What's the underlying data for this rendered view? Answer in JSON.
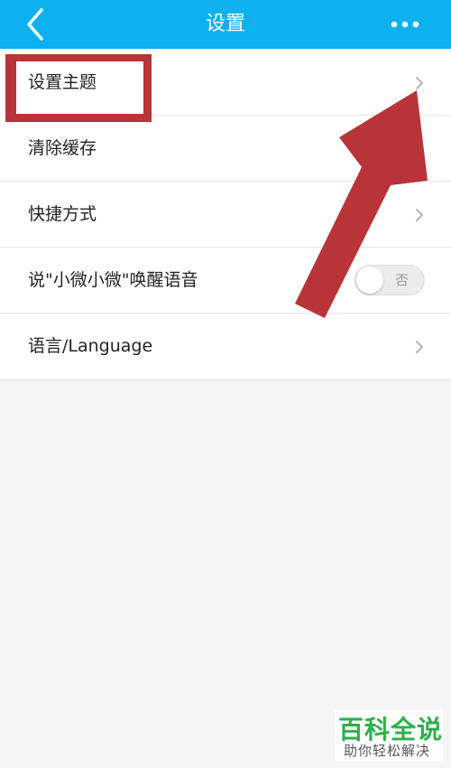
{
  "header": {
    "title": "设置",
    "back_icon": "chevron-left-icon",
    "more_icon": "more-dots-icon",
    "background": "#0db1f0"
  },
  "settings": {
    "items": [
      {
        "label": "设置主题",
        "control": "chevron-right-icon"
      },
      {
        "label": "清除缓存",
        "control": "none"
      },
      {
        "label": "快捷方式",
        "control": "chevron-right-icon"
      },
      {
        "label": "说\"小微小微\"唤醒语音",
        "control": "toggle",
        "toggle_text": "否",
        "toggle_on": false
      },
      {
        "label": "语言/Language",
        "control": "chevron-right-icon"
      }
    ]
  },
  "annotation": {
    "color": "#b83438"
  },
  "watermark": {
    "title": "百科全说",
    "subtitle": "助你轻松解决",
    "color": "#2bb04a"
  }
}
